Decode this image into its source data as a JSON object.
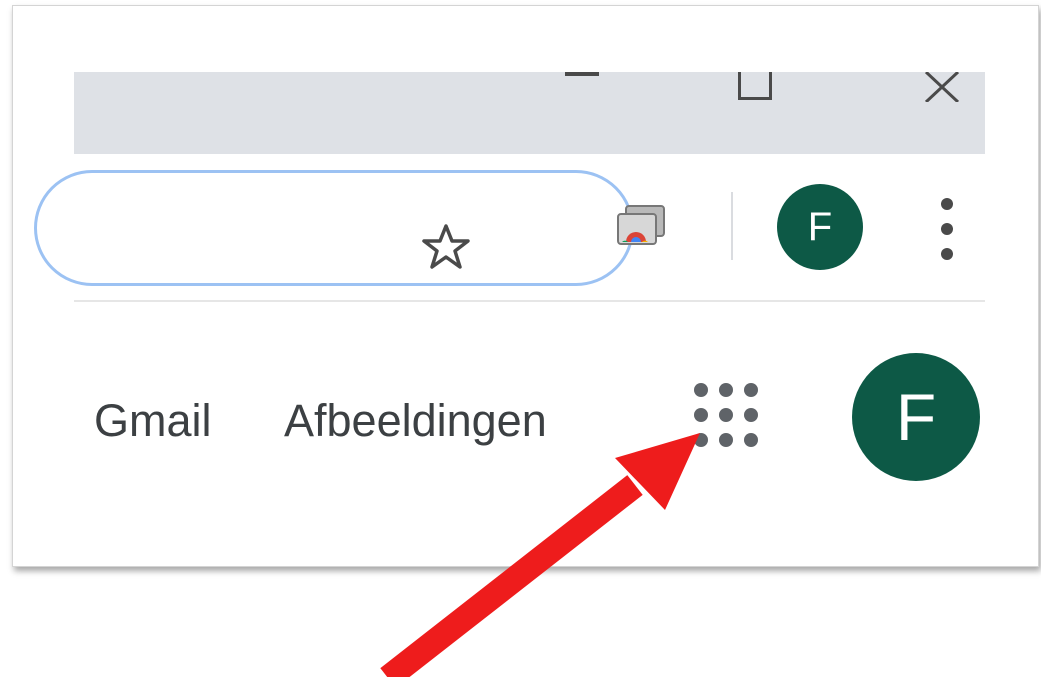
{
  "browser": {
    "window_controls": {
      "minimize_icon": "minimize-icon",
      "maximize_icon": "maximize-icon",
      "close_icon": "close-icon"
    },
    "toolbar": {
      "bookmark_icon": "star-icon",
      "cast_icon": "cast-icon",
      "profile_initial": "F",
      "menu_icon": "kebab-menu-icon"
    }
  },
  "google_bar": {
    "links": [
      "Gmail",
      "Afbeeldingen"
    ],
    "apps_icon": "apps-grid-icon",
    "account_initial": "F"
  },
  "annotation": {
    "arrow_color": "#ee1c1c",
    "points_to": "apps-grid-icon"
  },
  "colors": {
    "avatar_bg": "#0d5946",
    "tab_strip": "#dee1e6",
    "omnibox_border": "#9cc2f3"
  }
}
